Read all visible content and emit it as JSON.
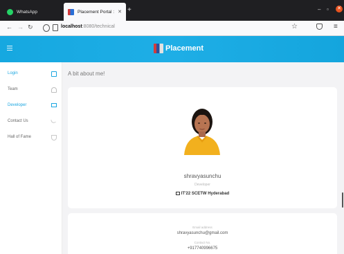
{
  "browser": {
    "tabs": [
      {
        "title": "WhatsApp"
      },
      {
        "title": "Placement Portal : Starti"
      }
    ],
    "url_host": "localhost",
    "url_path": ":8080/technical",
    "icons": [
      "back-icon",
      "forward-icon",
      "reload-icon",
      "star-icon",
      "pocket-icon",
      "menu-icon"
    ]
  },
  "header": {
    "brand": "Placement"
  },
  "sidebar": {
    "items": [
      {
        "label": "Login",
        "icon": "door-icon"
      },
      {
        "label": "Team",
        "icon": "bell-icon"
      },
      {
        "label": "Developer",
        "icon": "monitor-icon"
      },
      {
        "label": "Contact Us",
        "icon": "phone-icon"
      },
      {
        "label": "Hall of Fame",
        "icon": "trophy-icon"
      }
    ]
  },
  "main": {
    "section_title": "A bit about me!",
    "profile": {
      "name": "shravyasunchu",
      "role": "Developer",
      "college": "IT'22 SCETW Hyderabad",
      "email_label": "Email address",
      "email": "shravyasunchu@gmail.com",
      "contact_label": "Contact No.",
      "contact": "+917740996675"
    }
  },
  "colors": {
    "accent": "#1aa6e0",
    "header_bg": "#16a8e0",
    "page_bg": "#f3f3f5"
  }
}
